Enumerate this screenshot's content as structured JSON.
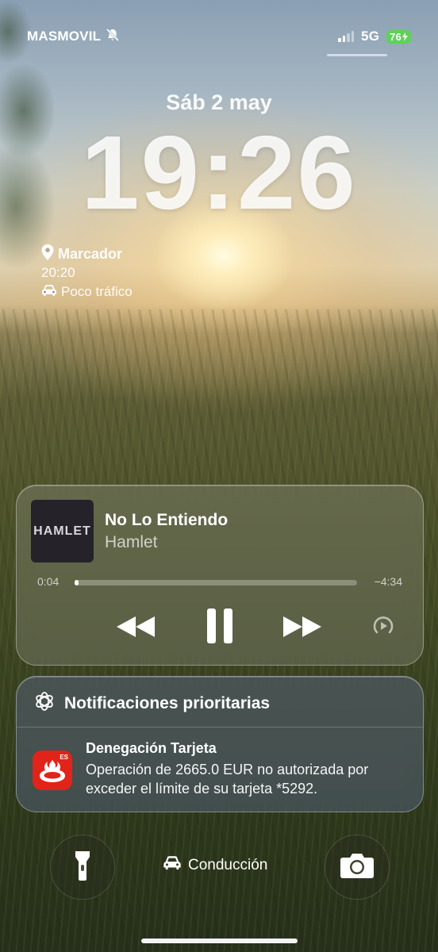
{
  "status_bar": {
    "carrier": "MASMOVIL",
    "network": "5G",
    "battery": "76"
  },
  "lock_screen": {
    "date": "Sáb 2 may",
    "time": "19:26"
  },
  "widget": {
    "place": "Marcador",
    "eta": "20:20",
    "traffic": "Poco tráfico"
  },
  "player": {
    "album_art_text": "HAMLET",
    "song": "No Lo Entiendo",
    "artist": "Hamlet",
    "elapsed": "0:04",
    "remaining": "−4:34",
    "progress_fraction": 0.015
  },
  "notifications": {
    "header": "Notificaciones prioritarias",
    "items": [
      {
        "app_badge": "ES",
        "title": "Denegación Tarjeta",
        "body": "Operación de 2665.0 EUR no autorizada por exceder el límite de su tarjeta *5292."
      }
    ]
  },
  "bottom": {
    "focus_mode": "Conducción"
  },
  "icons": [
    "bell-slash-icon",
    "signal-icon",
    "battery-icon",
    "location-pin-icon",
    "car-icon",
    "rewind-icon",
    "pause-icon",
    "fast-forward-icon",
    "airplay-icon",
    "priority-icon",
    "santander-icon",
    "flashlight-icon",
    "camera-icon"
  ],
  "colors": {
    "battery_green": "#5ed15b",
    "santander_red": "#e2231a"
  }
}
